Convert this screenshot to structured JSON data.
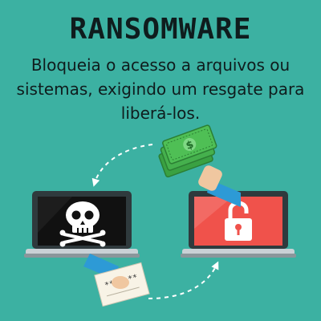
{
  "title": "RANSOMWARE",
  "subtitle": "Bloqueia o acesso a arquivos ou sistemas, exigindo um resgate para liberá-los.",
  "money_symbol": "$",
  "ransom_note_text": "**** **",
  "colors": {
    "background": "#3cb1a2",
    "text": "#0f1c1d",
    "laptop_frame": "#2f3a3d",
    "infected_screen": "#111111",
    "locked_screen": "#f0524b",
    "money": "#4fbf55",
    "sleeve": "#2d9ad6",
    "skin": "#f0c7a0"
  },
  "icons": [
    "skull-icon",
    "padlock-icon",
    "money-icon",
    "ransom-note-icon"
  ]
}
